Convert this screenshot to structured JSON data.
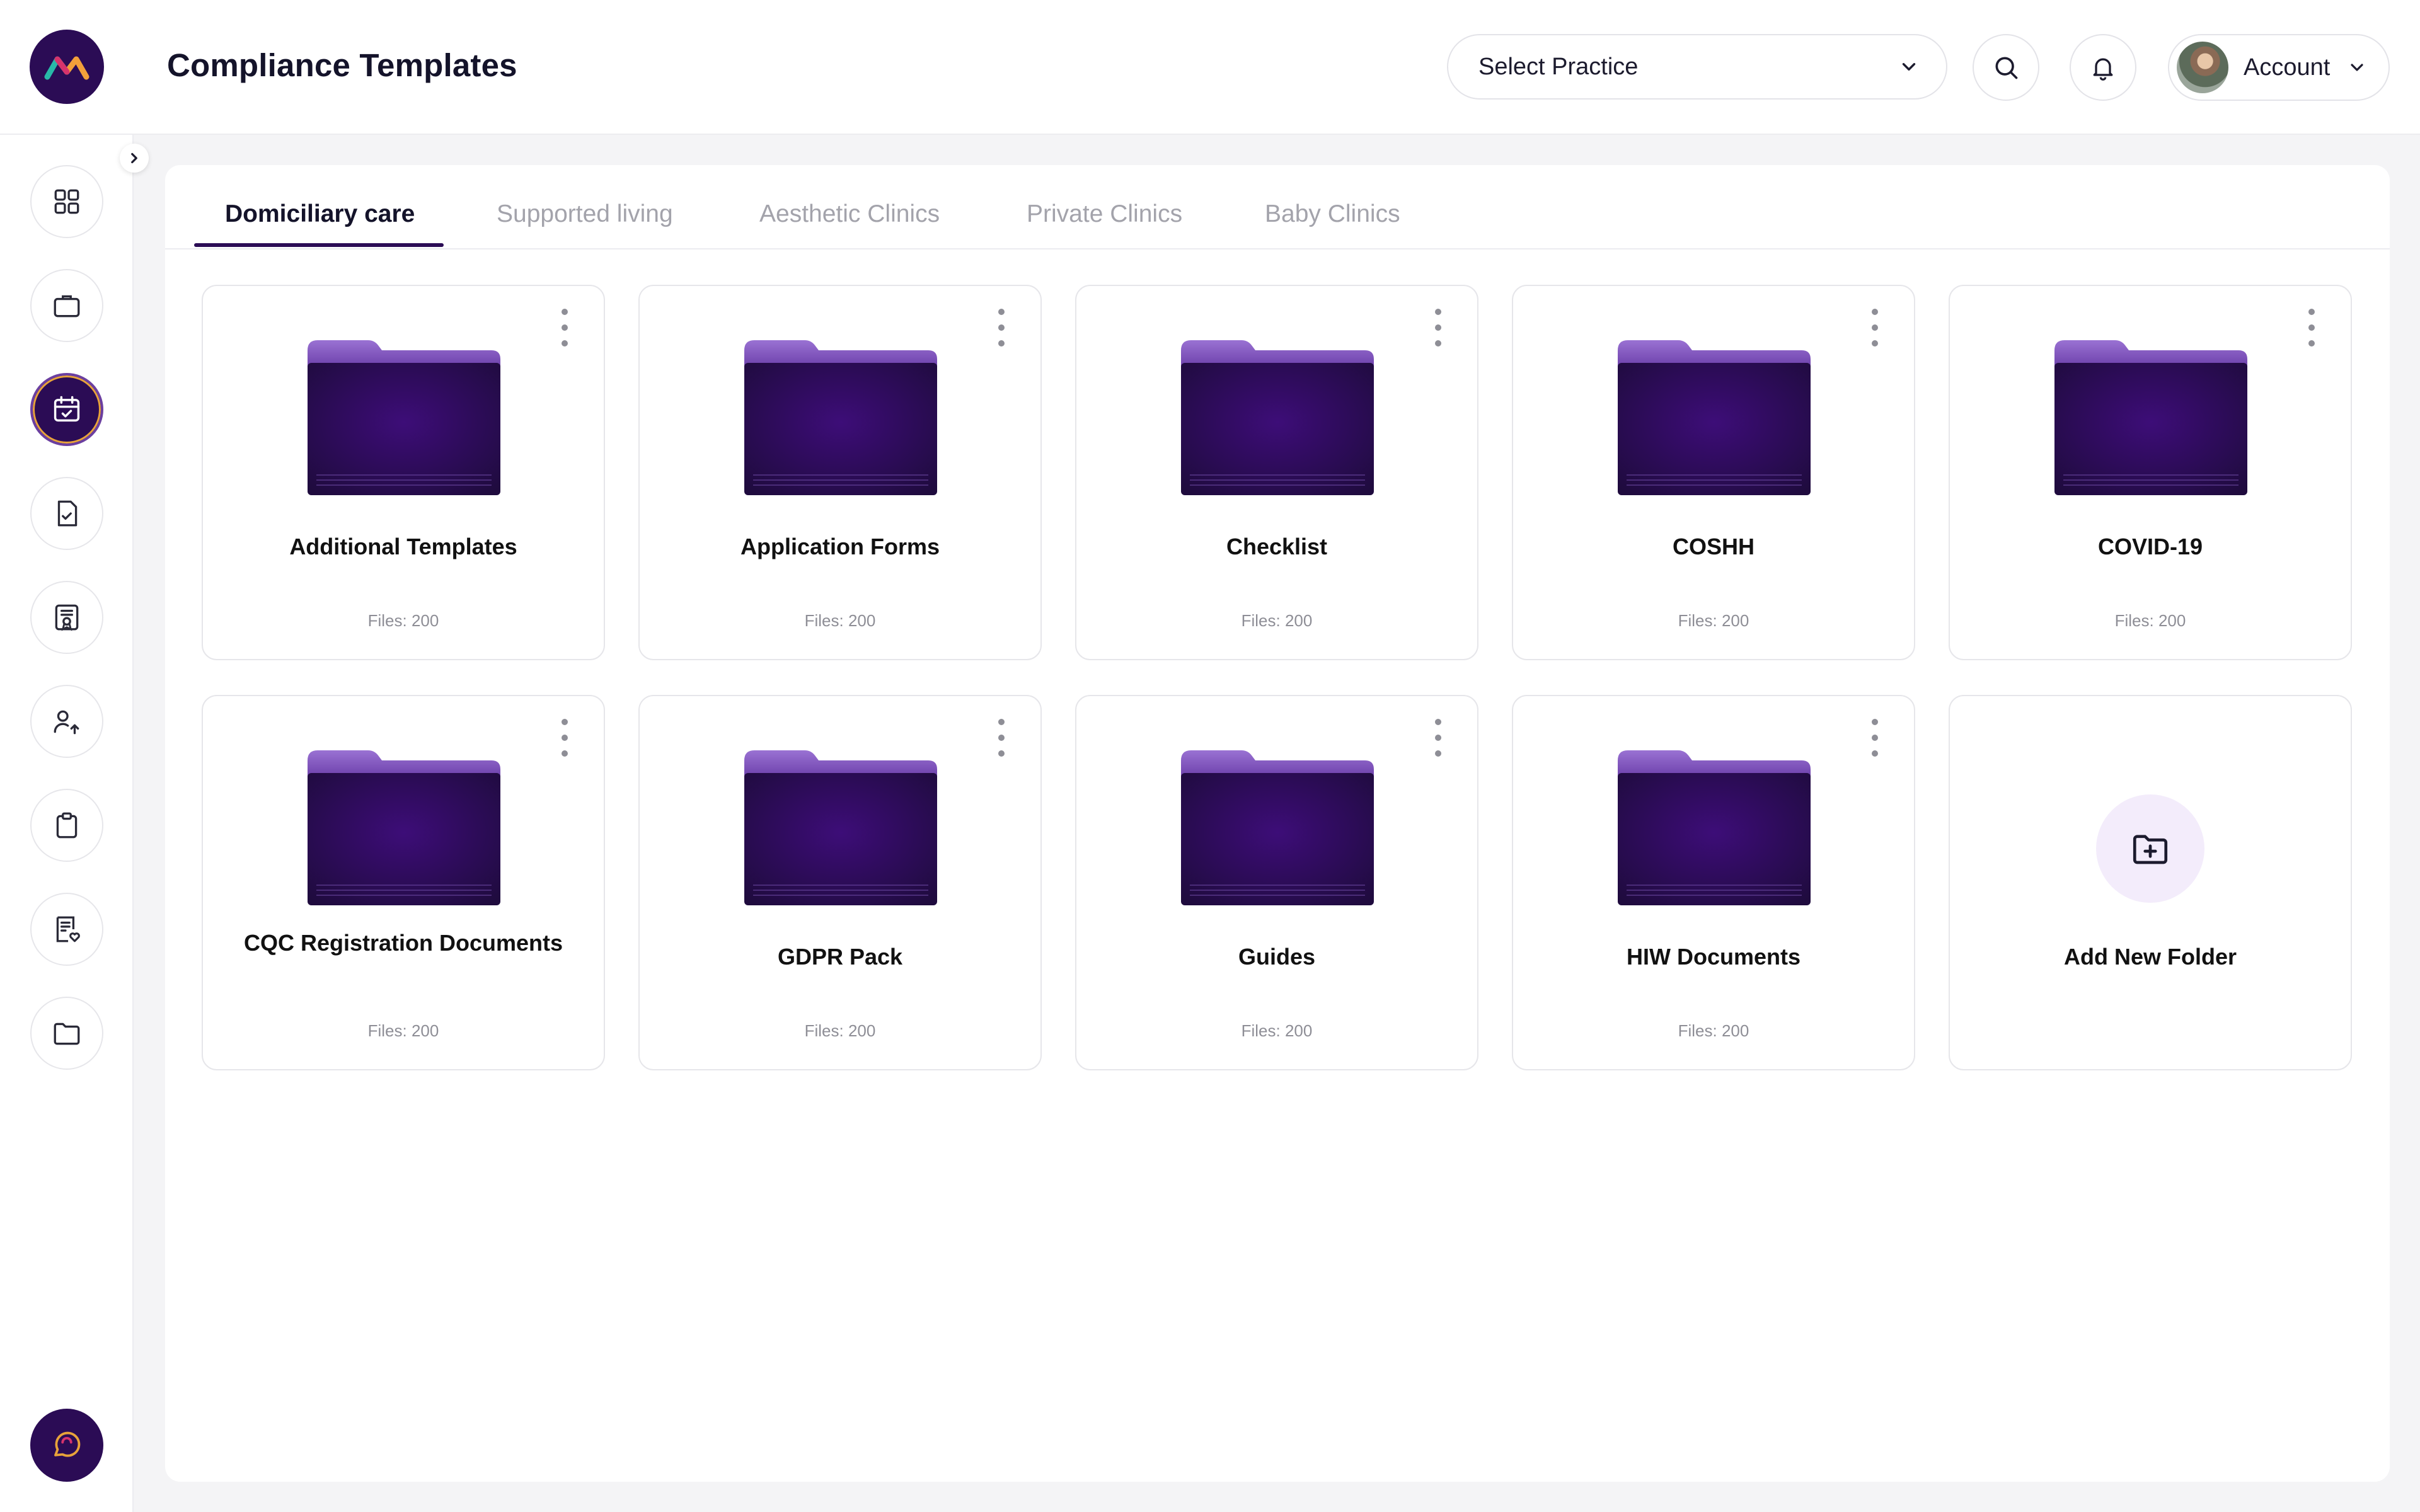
{
  "header": {
    "title": "Compliance Templates",
    "practice_select": {
      "value": "Select Practice"
    },
    "account_label": "Account"
  },
  "tabs": [
    {
      "label": "Domiciliary care",
      "active": true
    },
    {
      "label": "Supported living",
      "active": false
    },
    {
      "label": "Aesthetic Clinics",
      "active": false
    },
    {
      "label": "Private Clinics",
      "active": false
    },
    {
      "label": "Baby Clinics",
      "active": false
    }
  ],
  "folders": [
    {
      "name": "Additional Templates",
      "files": "Files: 200"
    },
    {
      "name": "Application Forms",
      "files": "Files: 200"
    },
    {
      "name": "Checklist",
      "files": "Files: 200"
    },
    {
      "name": "COSHH",
      "files": "Files: 200"
    },
    {
      "name": "COVID-19",
      "files": "Files: 200"
    },
    {
      "name": "CQC Registration Documents",
      "files": "Files: 200"
    },
    {
      "name": "GDPR Pack",
      "files": "Files: 200"
    },
    {
      "name": "Guides",
      "files": "Files: 200"
    },
    {
      "name": "HIW Documents",
      "files": "Files: 200"
    }
  ],
  "add_folder_label": "Add New Folder",
  "sidebar": {
    "items": [
      {
        "icon": "dashboard-grid-icon"
      },
      {
        "icon": "briefcase-icon"
      },
      {
        "icon": "calendar-check-icon",
        "active": true
      },
      {
        "icon": "document-check-icon"
      },
      {
        "icon": "certificate-icon"
      },
      {
        "icon": "users-upload-icon"
      },
      {
        "icon": "clipboard-icon"
      },
      {
        "icon": "document-heart-icon"
      },
      {
        "icon": "folder-icon"
      }
    ]
  },
  "colors": {
    "brand": "#2b0c55",
    "accent_light": "#f3ecfb",
    "tab_inactive": "#a3a3ab"
  }
}
